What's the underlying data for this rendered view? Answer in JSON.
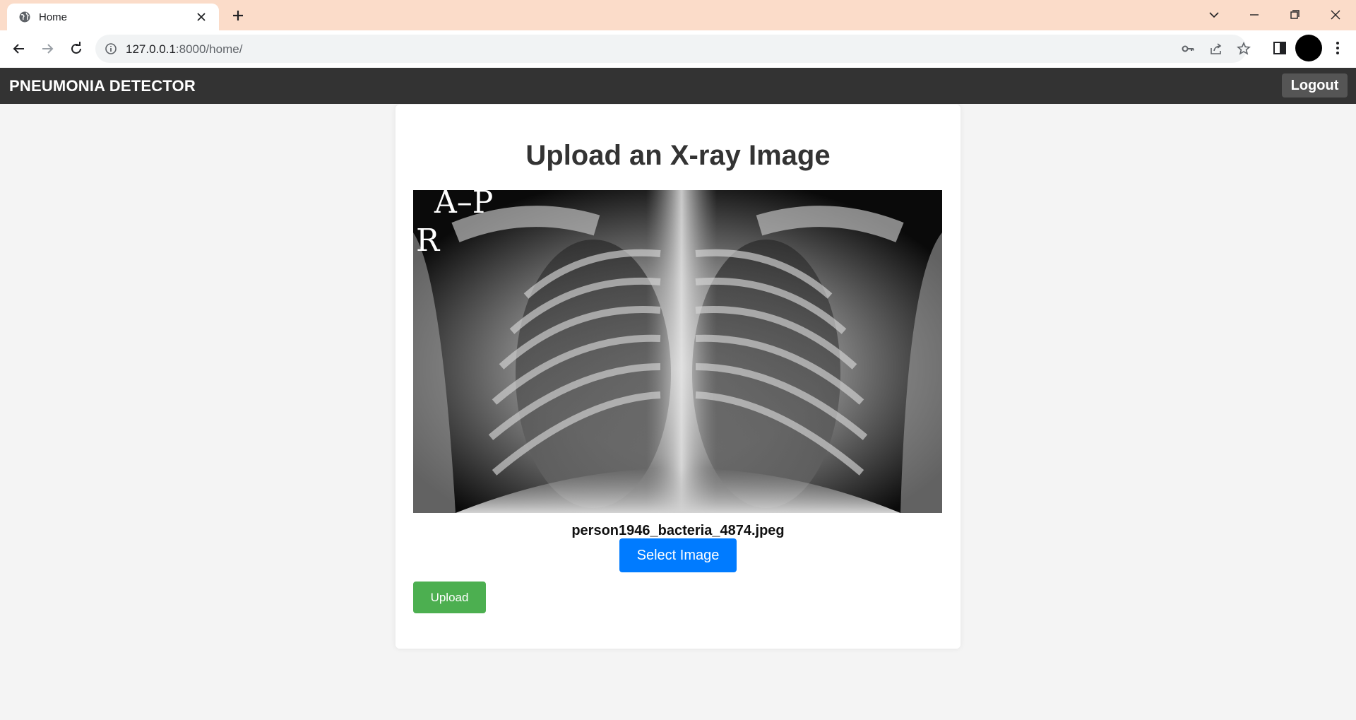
{
  "browser": {
    "tab_title": "Home",
    "url_host": "127.0.0.1",
    "url_path": ":8000/home/"
  },
  "app": {
    "brand": "PNEUMONIA DETECTOR",
    "logout_label": "Logout"
  },
  "upload": {
    "title": "Upload an X-ray Image",
    "filename": "person1946_bacteria_4874.jpeg",
    "select_label": "Select Image",
    "upload_label": "Upload",
    "xray_marker_top": "A–P",
    "xray_marker_side": "R"
  },
  "colors": {
    "navbar": "#333333",
    "select_button": "#007bff",
    "upload_button": "#4caf50",
    "tabstrip": "#fbdcc9"
  },
  "icons": [
    "globe-icon",
    "close-icon",
    "plus-icon",
    "chevron-down-icon",
    "minimize-icon",
    "restore-icon",
    "back-icon",
    "forward-icon",
    "reload-icon",
    "info-icon",
    "key-icon",
    "share-icon",
    "star-icon",
    "side-panel-icon",
    "kebab-menu-icon"
  ]
}
